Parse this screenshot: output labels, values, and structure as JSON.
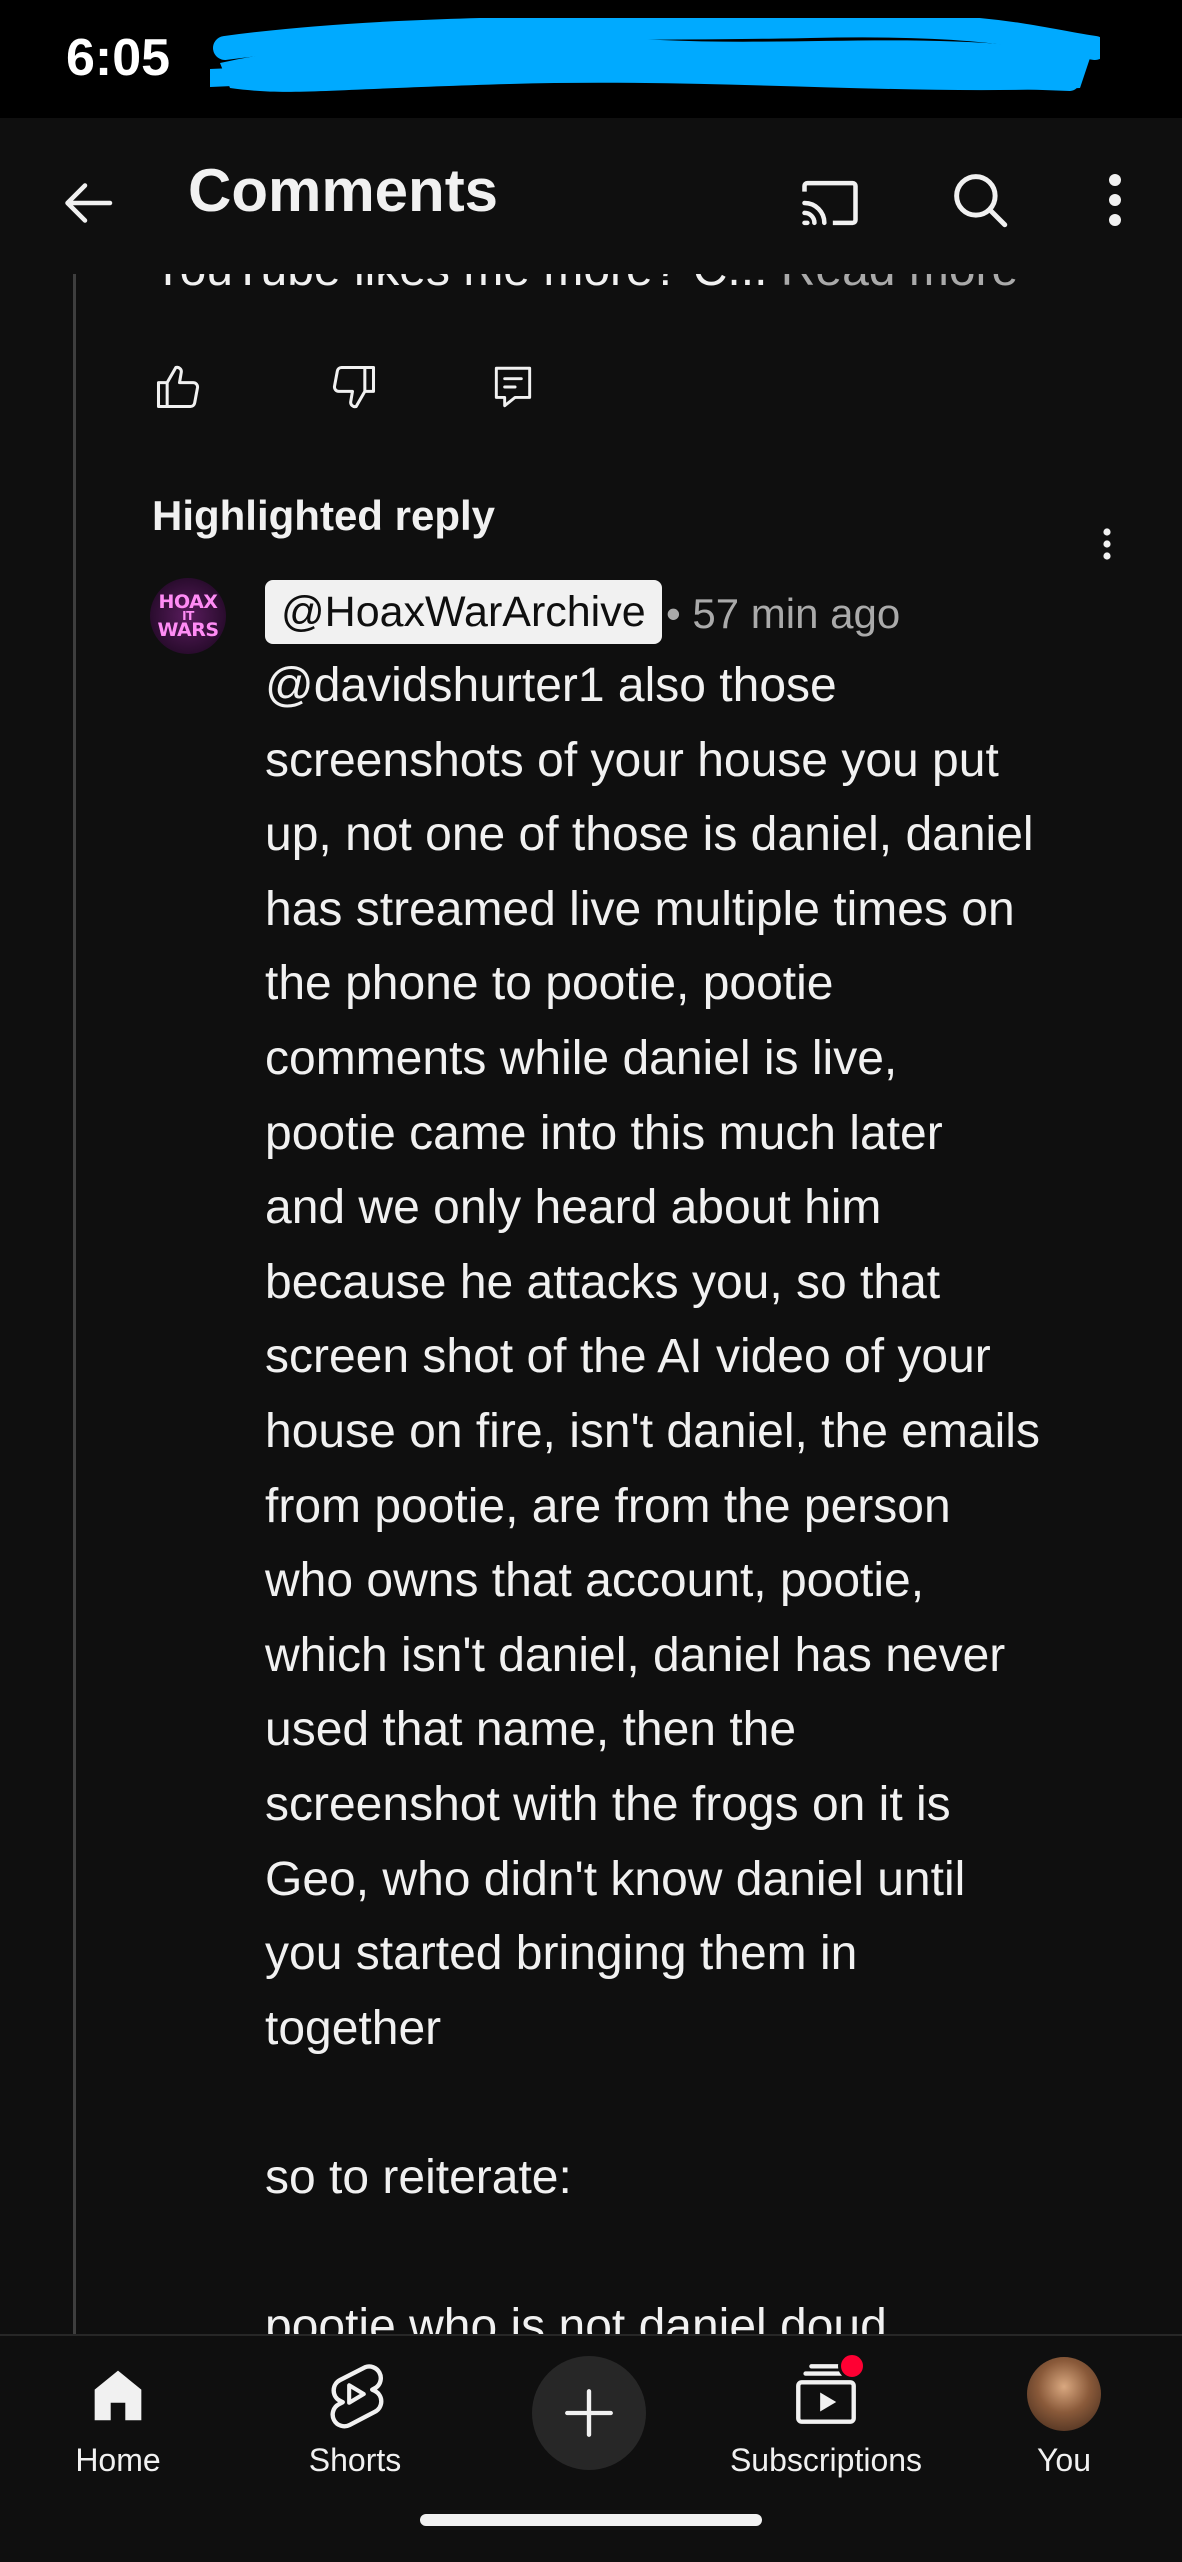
{
  "status_bar": {
    "time": "6:05"
  },
  "app_bar": {
    "title": "Comments",
    "back_icon": "arrow-left-icon",
    "cast_icon": "cast-icon",
    "search_icon": "search-icon",
    "more_icon": "more-vertical-icon"
  },
  "previous_comment": {
    "truncated_text": "YouTube likes me more? C...",
    "read_more": "Read more"
  },
  "reply": {
    "section_label": "Highlighted reply",
    "author": "@HoaxWarArchive",
    "avatar_text": [
      "HOAX",
      "IT",
      "WARS"
    ],
    "time_ago": "• 57 min ago",
    "lines": [
      "@davidshurter1 also those",
      "screenshots of your house you put",
      "up, not one of those is daniel, daniel",
      "has streamed live multiple times on",
      "the phone to pootie, pootie",
      "comments while daniel is live,",
      "pootie came into this much later",
      "and we only heard about him",
      "because he attacks you, so that",
      "screen shot of the AI video of your",
      "house on fire, isn't daniel, the emails",
      "from pootie, are from the person",
      "who owns that account, pootie,",
      "which isn't daniel, daniel has never",
      "used that name, then the",
      "screenshot with the frogs on it is",
      "Geo, who didn't know daniel until",
      "you started bringing them in",
      "together",
      "",
      "so to reiterate:",
      "",
      "pootie who is not daniel doud"
    ]
  },
  "bottom_nav": {
    "items": [
      {
        "label": "Home",
        "icon": "home-icon"
      },
      {
        "label": "Shorts",
        "icon": "shorts-icon"
      },
      {
        "label": "",
        "icon": "plus-icon"
      },
      {
        "label": "Subscriptions",
        "icon": "subscriptions-icon"
      },
      {
        "label": "You",
        "icon": "profile-avatar"
      }
    ]
  },
  "colors": {
    "background": "#0f0f0f",
    "text": "#f1f1f1",
    "secondary_text": "#aaaaaa",
    "redaction": "#00aaff",
    "notification": "#ff0033"
  }
}
